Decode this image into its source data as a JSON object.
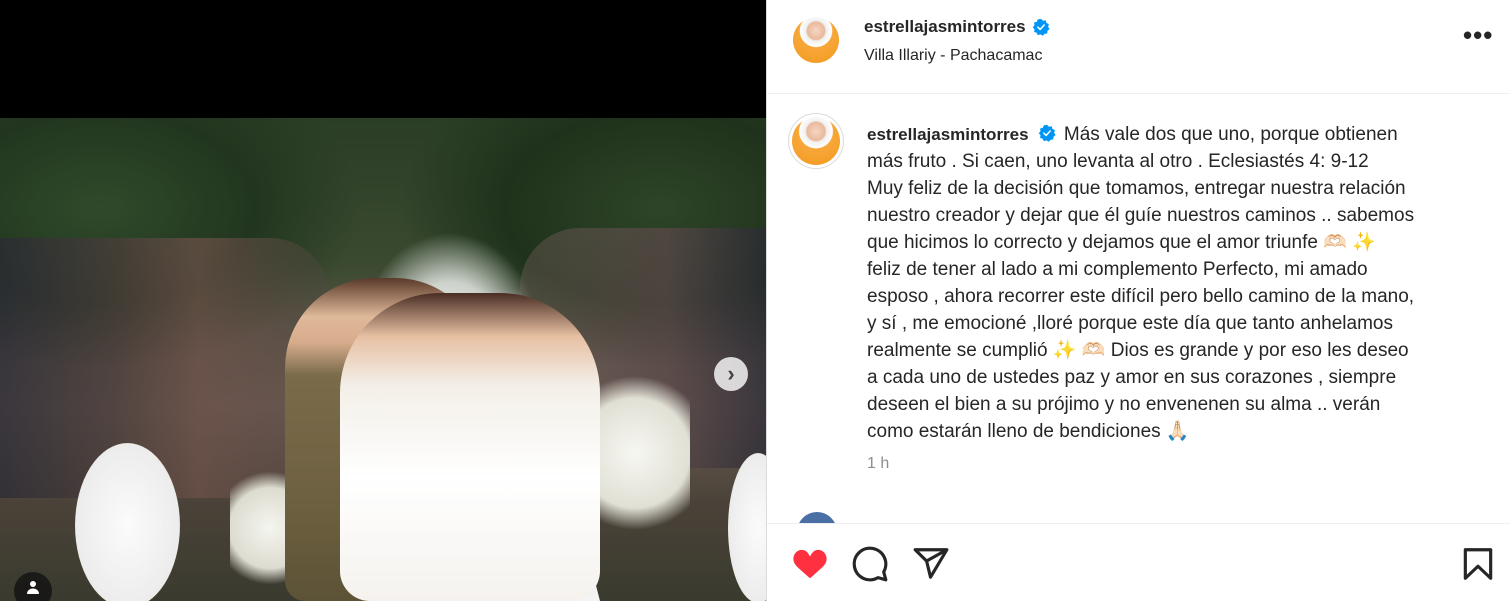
{
  "post": {
    "username": "estrellajasmintorres",
    "location": "Villa Illariy - Pachacamac",
    "caption_lines": [
      "Más vale dos que uno, porque obtienen",
      "más fruto . Si caen, uno levanta al otro . Eclesiastés 4: 9-12",
      "Muy feliz de la decisión que tomamos, entregar nuestra relación",
      "nuestro creador y dejar que él guíe nuestros caminos .. sabemos",
      "que hicimos lo correcto y dejamos que el amor triunfe 🫶🏻 ✨",
      "feliz de tener al lado a mi complemento Perfecto, mi amado",
      "esposo , ahora recorrer este difícil pero bello camino de la mano,",
      "y sí , me emocioné ,lloré porque este día que tanto anhelamos",
      "realmente se cumplió ✨ 🫶🏻  Dios es grande y por eso les deseo",
      "a cada uno de ustedes paz y amor en sus corazones , siempre",
      "deseen el bien a su prójimo y no envenenen su alma .. verán",
      "como estarán lleno de bendiciones 🙏🏻"
    ],
    "time": "1 h",
    "more_label": "•••",
    "next_label": "›"
  },
  "icons": {
    "verified": "verified-badge-icon",
    "like": "heart-icon",
    "comment": "comment-icon",
    "share": "share-icon",
    "save": "bookmark-icon",
    "tag": "user-tag-icon"
  },
  "colors": {
    "like": "#ff3040",
    "verified": "#0095f6",
    "text": "#262626",
    "muted": "#8e8e8e"
  }
}
